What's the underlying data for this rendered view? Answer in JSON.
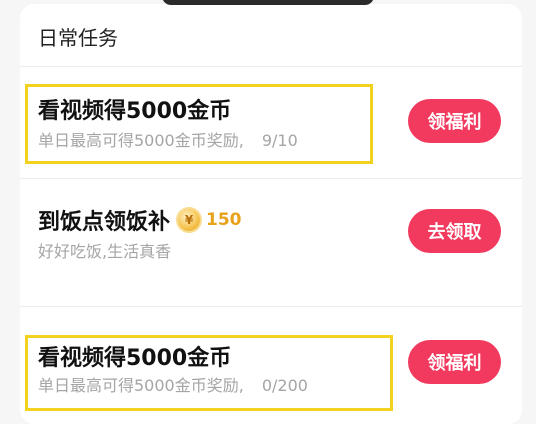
{
  "section": {
    "title": "日常任务"
  },
  "tasks": [
    {
      "title": "看视频得5000金币",
      "desc": "单日最高可得5000金币奖励,",
      "progress": "9/10",
      "button": "领福利"
    },
    {
      "title": "到饭点领饭补",
      "coin_symbol": "¥",
      "coin_amount": "150",
      "desc": "好好吃饭,生活真香",
      "button": "去领取"
    },
    {
      "title": "看视频得5000金币",
      "desc": "单日最高可得5000金币奖励,",
      "progress": "0/200",
      "button": "领福利"
    }
  ],
  "colors": {
    "button": "#f23a5e",
    "highlight": "#f2d21f",
    "coin": "#e7a21a"
  }
}
